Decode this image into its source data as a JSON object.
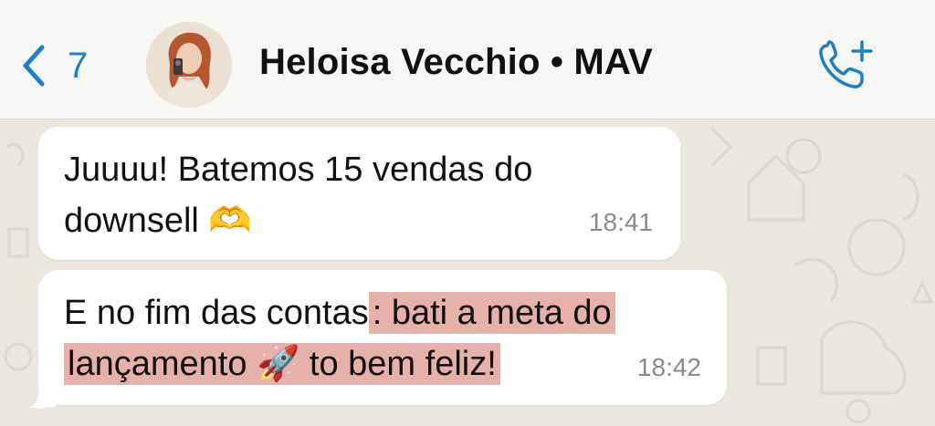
{
  "header": {
    "back_count": "7",
    "contact_name": "Heloisa Vecchio • MAV"
  },
  "messages": [
    {
      "line1": "Juuuu! Batemos 15 vendas do",
      "line2_text": "downsell ",
      "line2_emoji": "🫶",
      "time": "18:41"
    },
    {
      "line1_plain": "E no fim das contas",
      "line1_highlight": ": bati a meta do",
      "line2_highlight_a": "lançamento ",
      "line2_emoji": "🚀",
      "line2_highlight_b": " to bem feliz!",
      "time": "18:42"
    }
  ],
  "colors": {
    "accent": "#1f7fc4",
    "highlight": "#e6b0ab",
    "chat_bg": "#ebe6de",
    "bubble": "#ffffff"
  },
  "icons": {
    "back": "chevron-left-icon",
    "call": "phone-add-icon"
  }
}
